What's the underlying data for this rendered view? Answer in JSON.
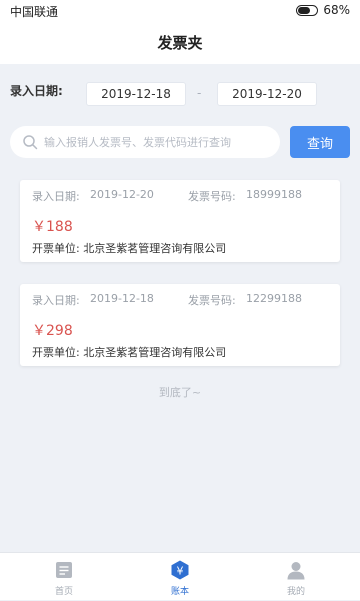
{
  "status_bar": {
    "carrier": "中国联通",
    "battery_percent": "68%",
    "battery_level": 0.68
  },
  "header": {
    "title": "发票夹"
  },
  "filter": {
    "date_label": "录入日期:",
    "start_date": "2019-12-18",
    "end_date": "2019-12-20",
    "separator": "-"
  },
  "search": {
    "placeholder": "输入报销人发票号、发票代码进行查询",
    "value": "",
    "button_label": "查询"
  },
  "invoices": [
    {
      "entry_date_label": "录入日期:",
      "entry_date": "2019-12-20",
      "invoice_no_label": "发票号码:",
      "invoice_no": "18999188",
      "amount": "￥188",
      "issuer_label": "开票单位:",
      "issuer": "北京圣紫茗管理咨询有限公司"
    },
    {
      "entry_date_label": "录入日期:",
      "entry_date": "2019-12-18",
      "invoice_no_label": "发票号码:",
      "invoice_no": "12299188",
      "amount": "￥298",
      "issuer_label": "开票单位:",
      "issuer": "北京圣紫茗管理咨询有限公司"
    }
  ],
  "list_end_text": "到底了~",
  "tab_bar": {
    "items": [
      {
        "label": "首页",
        "icon": "home-icon",
        "active": false
      },
      {
        "label": "账本",
        "icon": "ledger-icon",
        "active": true
      },
      {
        "label": "我的",
        "icon": "person-icon",
        "active": false
      }
    ]
  },
  "colors": {
    "accent": "#4a8ef0",
    "active_tab": "#2f6fd1",
    "amount": "#d9534f",
    "background": "#eef1f6"
  }
}
